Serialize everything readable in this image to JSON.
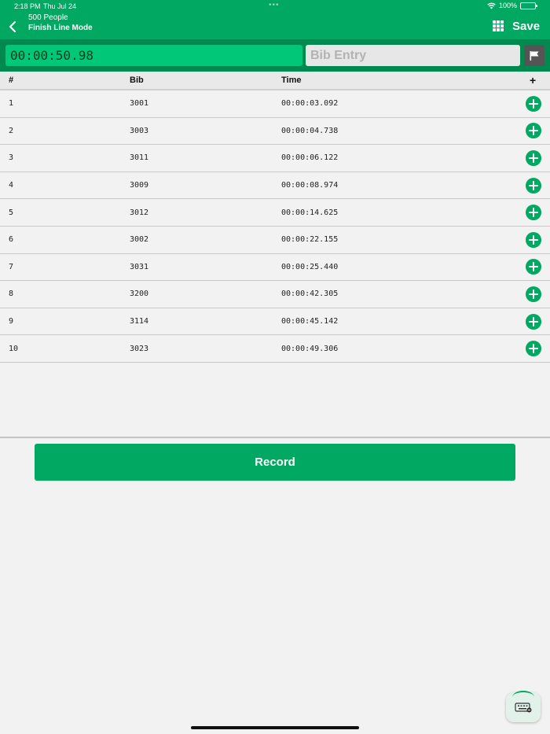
{
  "status_bar": {
    "time": "2:18 PM",
    "date": "Thu Jul 24",
    "battery": "100%",
    "battery_level": 1.0
  },
  "header": {
    "event_name": "500 People",
    "mode": "Finish Line Mode",
    "save_label": "Save",
    "back_icon": "chevron-left-icon",
    "grid_icon": "grid-icon"
  },
  "entry": {
    "timer": "00:00:50.98",
    "bib_placeholder": "Bib Entry",
    "flag_icon": "flag-icon"
  },
  "table": {
    "headers": {
      "num": "#",
      "bib": "Bib",
      "time": "Time",
      "add": "+"
    },
    "rows": [
      {
        "num": "1",
        "bib": "3001",
        "time": "00:00:03.092"
      },
      {
        "num": "2",
        "bib": "3003",
        "time": "00:00:04.738"
      },
      {
        "num": "3",
        "bib": "3011",
        "time": "00:00:06.122"
      },
      {
        "num": "4",
        "bib": "3009",
        "time": "00:00:08.974"
      },
      {
        "num": "5",
        "bib": "3012",
        "time": "00:00:14.625"
      },
      {
        "num": "6",
        "bib": "3002",
        "time": "00:00:22.155"
      },
      {
        "num": "7",
        "bib": "3031",
        "time": "00:00:25.440"
      },
      {
        "num": "8",
        "bib": "3200",
        "time": "00:00:42.305"
      },
      {
        "num": "9",
        "bib": "3114",
        "time": "00:00:45.142"
      },
      {
        "num": "10",
        "bib": "3023",
        "time": "00:00:49.306"
      }
    ]
  },
  "record_label": "Record",
  "colors": {
    "primary": "#00a862",
    "primary_dark": "#008a50",
    "timer_bg": "#00c878",
    "background": "#f2f2f2"
  },
  "keyboard_icon": "keyboard-icon"
}
